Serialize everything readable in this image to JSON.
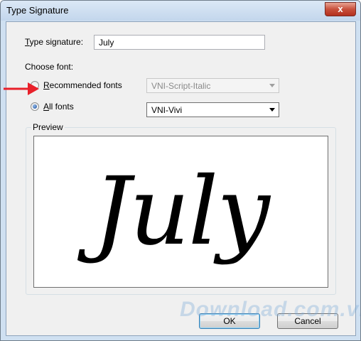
{
  "window": {
    "title": "Type Signature",
    "close_glyph": "x"
  },
  "signature": {
    "label_underlined": "T",
    "label_rest": "ype signature:",
    "value": "July"
  },
  "choose_font": {
    "label": "Choose font:"
  },
  "recommended": {
    "label_underlined": "R",
    "label_rest": "ecommended fonts",
    "selected": false,
    "dropdown_value": "VNI-Script-Italic",
    "enabled": false
  },
  "all_fonts": {
    "label_underlined": "A",
    "label_rest": "ll fonts",
    "selected": true,
    "dropdown_value": "VNI-Vivi",
    "enabled": true
  },
  "preview": {
    "group_label": "Preview",
    "text": "July"
  },
  "buttons": {
    "ok": "OK",
    "cancel": "Cancel"
  },
  "watermark": "Download.com.vn",
  "colors": {
    "arrow": "#e8202a",
    "close": "#c8503c"
  }
}
